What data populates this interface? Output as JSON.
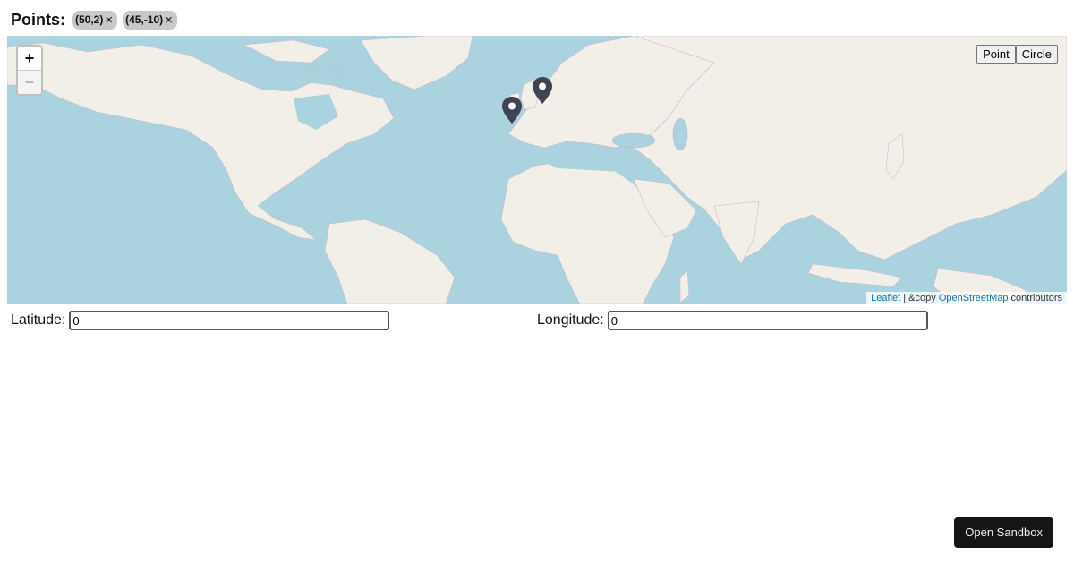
{
  "header": {
    "title": "Points:",
    "points": [
      {
        "label": "(50,2)",
        "remove_glyph": "×"
      },
      {
        "label": "(45,-10)",
        "remove_glyph": "×"
      }
    ]
  },
  "map": {
    "zoom_in_label": "+",
    "zoom_out_label": "−",
    "mode_buttons": {
      "point": "Point",
      "circle": "Circle"
    },
    "attribution": {
      "leaflet": "Leaflet",
      "separator": " | ",
      "copy_text": "&copy ",
      "osm": "OpenStreetMap",
      "contributors": " contributors"
    },
    "colors": {
      "water": "#aad3df",
      "land": "#f2efe9",
      "marker": "#3f4352"
    },
    "marker_icon": "map-pin-icon"
  },
  "form": {
    "latitude_label": "Latitude:",
    "latitude_value": "0",
    "longitude_label": "Longitude:",
    "longitude_value": "0"
  },
  "footer": {
    "sandbox_label": "Open Sandbox"
  }
}
